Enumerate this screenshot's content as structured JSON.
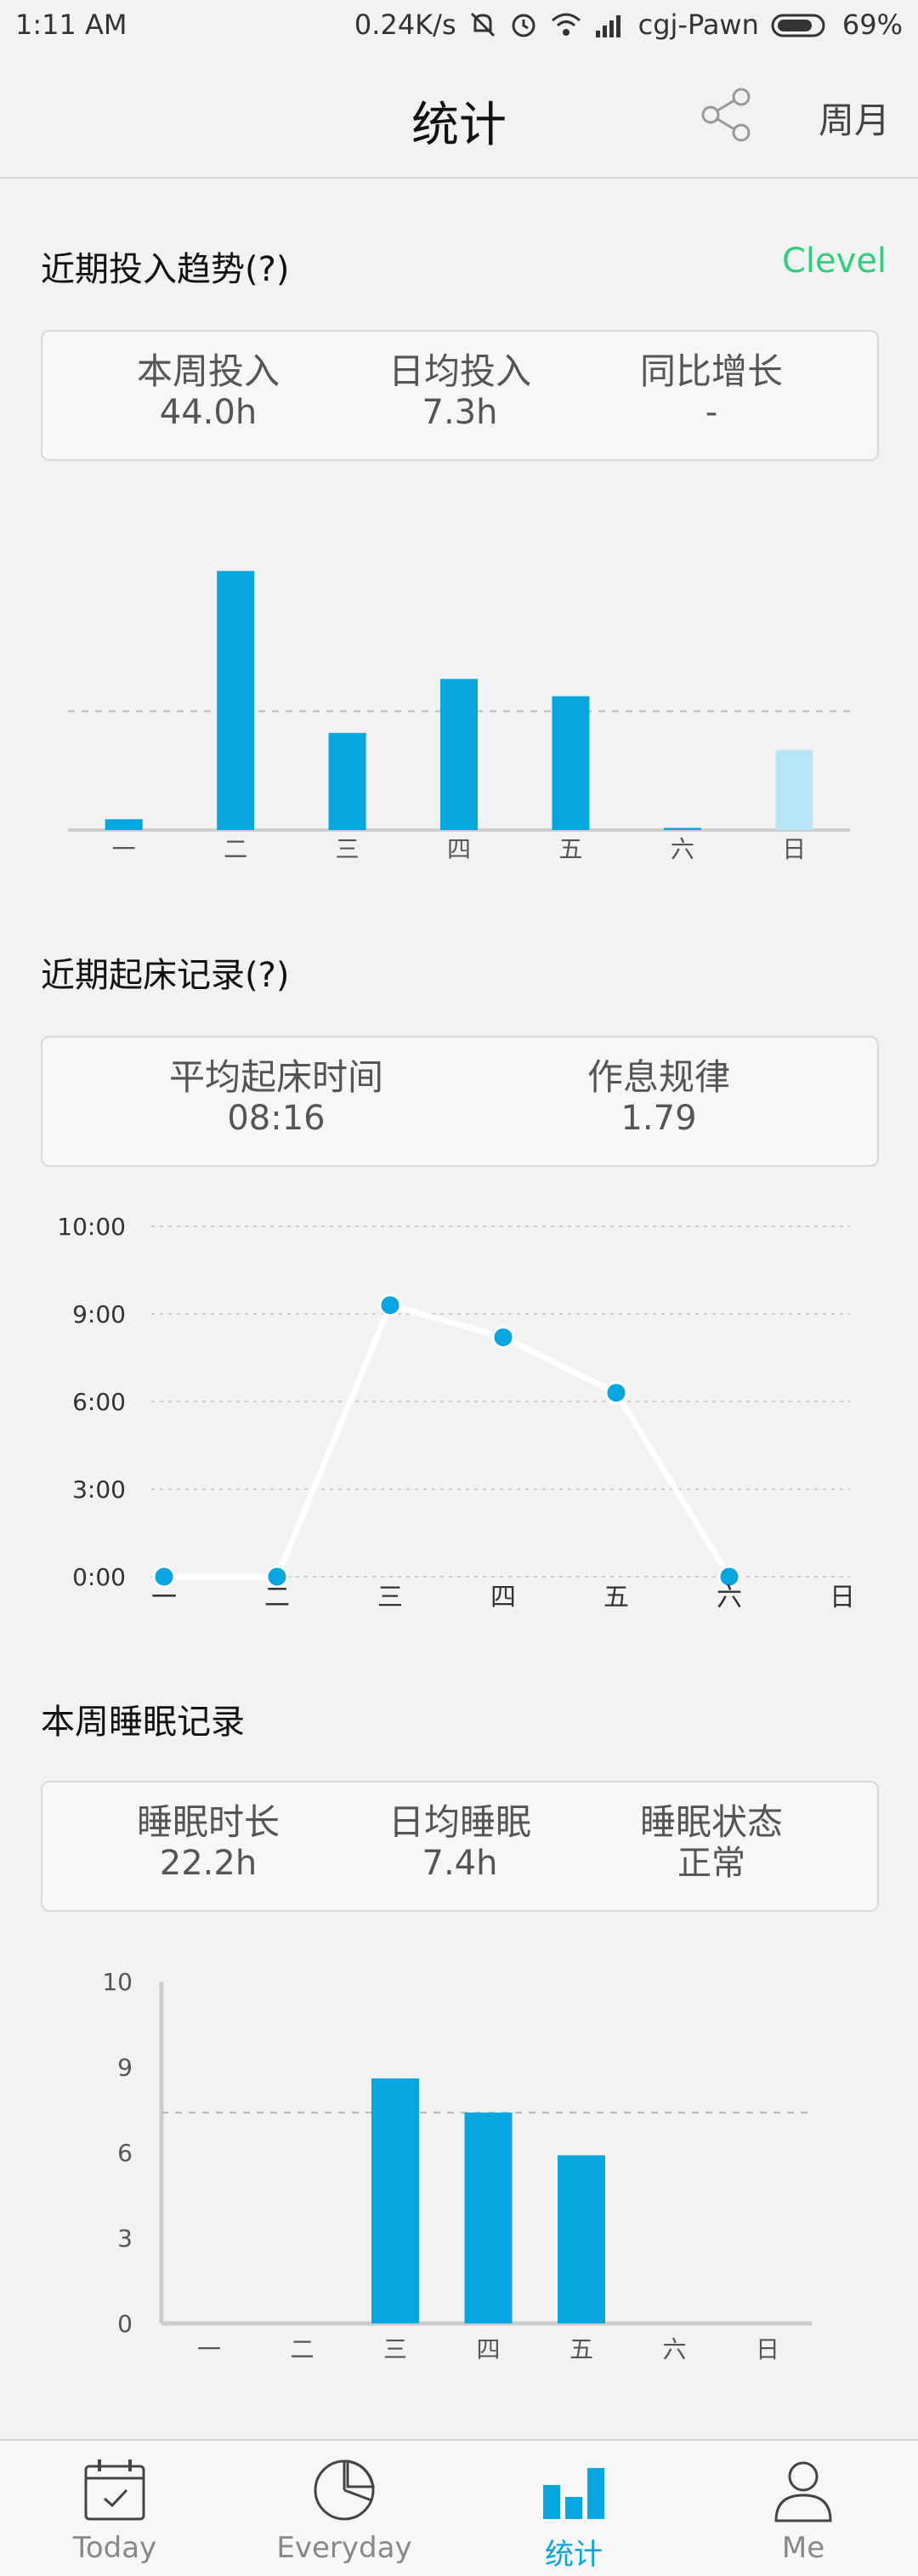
{
  "status_bar": {
    "time": "1:11 AM",
    "network_speed": "0.24K/s",
    "carrier": "cgj-Pawn",
    "battery": "69%"
  },
  "header": {
    "title": "统计",
    "share_icon": "share-icon",
    "period_label": "周月"
  },
  "trend": {
    "title": "近期投入趋势(?)",
    "link": "Clevel",
    "metrics": [
      {
        "label": "本周投入",
        "value": "44.0h"
      },
      {
        "label": "日均投入",
        "value": "7.3h"
      },
      {
        "label": "同比增长",
        "value": "-"
      }
    ]
  },
  "wake": {
    "title": "近期起床记录(?)",
    "metrics": [
      {
        "label": "平均起床时间",
        "value": "08:16"
      },
      {
        "label": "作息规律",
        "value": "1.79"
      }
    ]
  },
  "sleep": {
    "title": "本周睡眠记录",
    "metrics": [
      {
        "label": "睡眠时长",
        "value": "22.2h"
      },
      {
        "label": "日均睡眠",
        "value": "7.4h"
      },
      {
        "label": "睡眠状态",
        "value": "正常"
      }
    ]
  },
  "chart_data": [
    {
      "type": "bar",
      "categories": [
        "一",
        "二",
        "三",
        "四",
        "五",
        "六",
        "日"
      ],
      "values": [
        0.5,
        12.0,
        4.5,
        7.0,
        6.2,
        0.1,
        3.7
      ],
      "reference_line": 5.5,
      "ylim": [
        0,
        13
      ],
      "grid": false,
      "highlight_last_bar": true,
      "colors": {
        "bar": "#06a6e0",
        "last_bar": "#b7e6f7",
        "reference": "#bbbbbb"
      }
    },
    {
      "type": "line",
      "x": [
        "一",
        "二",
        "三",
        "四",
        "五",
        "六",
        "日"
      ],
      "y": [
        0,
        0,
        9.3,
        8.2,
        6.3,
        0,
        null
      ],
      "yticks": [
        "0:00",
        "3:00",
        "6:00",
        "9:00",
        "10:00"
      ],
      "grid": true,
      "colors": {
        "line": "#ffffff",
        "point": "#06a6e0",
        "grid": "#cccccc"
      }
    },
    {
      "type": "bar",
      "categories": [
        "一",
        "二",
        "三",
        "四",
        "五",
        "六",
        "日"
      ],
      "values": [
        0,
        0,
        8.6,
        7.4,
        5.9,
        0,
        0
      ],
      "reference_line": 7.4,
      "yticks": [
        "0",
        "3",
        "6",
        "9",
        "10"
      ],
      "ylim": [
        0,
        12
      ],
      "grid": false,
      "colors": {
        "bar": "#06a6e0",
        "reference": "#bbbbbb",
        "axis": "#cccccc"
      }
    }
  ],
  "bottom_nav": [
    {
      "label": "Today",
      "icon": "calendar-check-icon",
      "active": false
    },
    {
      "label": "Everyday",
      "icon": "pie-chart-icon",
      "active": false
    },
    {
      "label": "统计",
      "icon": "bar-chart-icon",
      "active": true
    },
    {
      "label": "Me",
      "icon": "person-icon",
      "active": false
    }
  ]
}
